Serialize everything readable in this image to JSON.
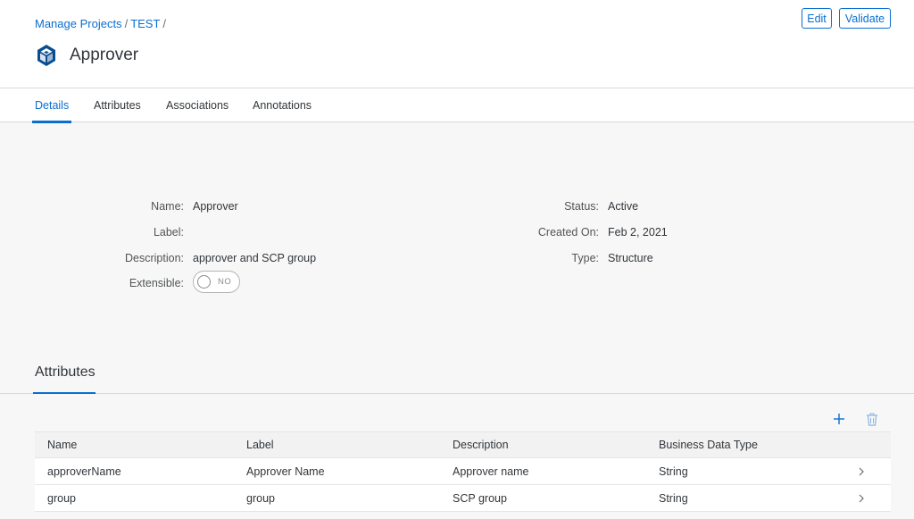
{
  "breadcrumb": [
    {
      "label": "Manage Projects"
    },
    {
      "label": "TEST"
    }
  ],
  "breadcrumb_sep": "/",
  "header": {
    "title": "Approver",
    "edit_label": "Edit",
    "validate_label": "Validate"
  },
  "tabs": [
    {
      "label": "Details",
      "active": true
    },
    {
      "label": "Attributes",
      "active": false
    },
    {
      "label": "Associations",
      "active": false
    },
    {
      "label": "Annotations",
      "active": false
    }
  ],
  "details": {
    "name_label": "Name:",
    "name_value": "Approver",
    "label_label": "Label:",
    "label_value": "",
    "description_label": "Description:",
    "description_value": "approver and SCP group",
    "extensible_label": "Extensible:",
    "extensible_toggle_text": "NO",
    "status_label": "Status:",
    "status_value": "Active",
    "created_on_label": "Created On:",
    "created_on_value": "Feb 2, 2021",
    "type_label": "Type:",
    "type_value": "Structure"
  },
  "attributes_section": {
    "title": "Attributes",
    "add_icon": "plus-icon",
    "delete_icon": "trash-icon",
    "columns": [
      "Name",
      "Label",
      "Description",
      "Business Data Type"
    ],
    "rows": [
      {
        "name": "approverName",
        "label": "Approver Name",
        "description": "Approver name",
        "type": "String"
      },
      {
        "name": "group",
        "label": "group",
        "description": "SCP group",
        "type": "String"
      }
    ]
  },
  "colors": {
    "accent": "#0a6ed1",
    "brand_icon": "#0a4d8f",
    "background": "#f7f7f7",
    "text": "#32363a"
  }
}
